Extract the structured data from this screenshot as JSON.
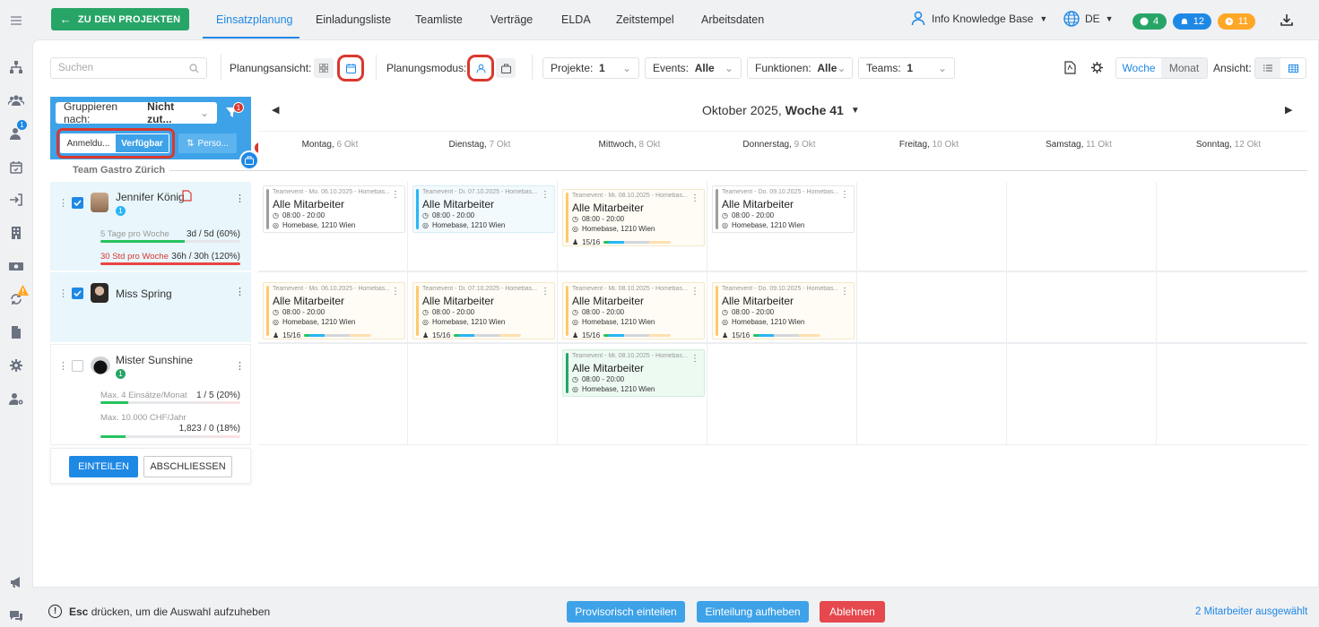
{
  "topbar": {
    "back_label": "ZU DEN PROJEKTEN",
    "tabs": [
      "Einsatzplanung",
      "Einladungsliste",
      "Teamliste",
      "Verträge",
      "ELDA",
      "Zeitstempel",
      "Arbeitsdaten"
    ],
    "user": "Info Knowledge Base",
    "language": "DE",
    "badges": {
      "messages": "4",
      "notifications": "12",
      "timers": "11"
    }
  },
  "toolbar": {
    "search_placeholder": "Suchen",
    "planungsansicht_label": "Planungsansicht:",
    "planungsmodus_label": "Planungsmodus:",
    "filters": [
      {
        "label": "Projekte:",
        "value": "1"
      },
      {
        "label": "Events:",
        "value": "Alle"
      },
      {
        "label": "Funktionen:",
        "value": "Alle"
      },
      {
        "label": "Teams:",
        "value": "1"
      }
    ],
    "woche": "Woche",
    "monat": "Monat",
    "ansicht_label": "Ansicht:"
  },
  "leftpanel": {
    "group_label": "Gruppieren nach:",
    "group_value": "Nicht zut...",
    "filter_badge": "1",
    "seg_left": "Anmeldu...",
    "seg_right": "Verfügbar",
    "sort_label": "Perso...",
    "float_badge": "1",
    "team_name": "Team Gastro Zürich"
  },
  "calendar": {
    "month": "Oktober 2025,",
    "week": "Woche 41",
    "days": [
      {
        "name": "Montag,",
        "date": "6 Okt"
      },
      {
        "name": "Dienstag,",
        "date": "7 Okt"
      },
      {
        "name": "Mittwoch,",
        "date": "8 Okt"
      },
      {
        "name": "Donnerstag,",
        "date": "9 Okt"
      },
      {
        "name": "Freitag,",
        "date": "10 Okt"
      },
      {
        "name": "Samstag,",
        "date": "11 Okt"
      },
      {
        "name": "Sonntag,",
        "date": "12 Okt"
      }
    ]
  },
  "people": [
    {
      "name": "Jennifer König",
      "badge": "1",
      "stat1_label": "5 Tage pro Woche",
      "stat1_value": "3d / 5d (60%)",
      "stat1_pct": 60,
      "stat2_label": "30 Std pro Woche",
      "stat2_value": "36h / 30h (120%)",
      "stat2_pct": 100
    },
    {
      "name": "Miss Spring"
    },
    {
      "name": "Mister Sunshine",
      "badge": "1",
      "stat1_label": "Max. 4 Einsätze/Monat",
      "stat1_value": "1 / 5 (20%)",
      "stat1_pct": 20,
      "stat2_label": "Max. 10.000 CHF/Jahr",
      "stat2_value": "1,823 / 0 (18%)",
      "stat2_pct": 18
    }
  ],
  "events": {
    "r1": [
      {
        "header": "Teamevent - Mo. 06.10.2025 - Homebas...",
        "title": "Alle Mitarbeiter",
        "time": "08:00 - 20:00",
        "place": "Homebase, 1210 Wien",
        "accent": "#9e9e9e"
      },
      {
        "header": "Teamevent - Di. 07.10.2025 - Homebas...",
        "title": "Alle Mitarbeiter",
        "time": "08:00 - 20:00",
        "place": "Homebase, 1210 Wien",
        "accent": "#29b6f6"
      },
      {
        "header": "Teamevent - Mi. 08.10.2025 - Homebas...",
        "title": "Alle Mitarbeiter",
        "time": "08:00 - 20:00",
        "place": "Homebase, 1210 Wien",
        "accent": "#ffc870",
        "count": "15/16"
      },
      {
        "header": "Teamevent - Do. 09.10.2025 - Homebas...",
        "title": "Alle Mitarbeiter",
        "time": "08:00 - 20:00",
        "place": "Homebase, 1210 Wien",
        "accent": "#9e9e9e"
      }
    ],
    "r2": [
      {
        "header": "Teamevent - Mo. 06.10.2025 - Homebas...",
        "title": "Alle Mitarbeiter",
        "time": "08:00 - 20:00",
        "place": "Homebase, 1210 Wien",
        "accent": "#ffc870",
        "count": "15/16"
      },
      {
        "header": "Teamevent - Di. 07.10.2025 - Homebas...",
        "title": "Alle Mitarbeiter",
        "time": "08:00 - 20:00",
        "place": "Homebase, 1210 Wien",
        "accent": "#ffc870",
        "count": "15/16"
      },
      {
        "header": "Teamevent - Mi. 08.10.2025 - Homebas...",
        "title": "Alle Mitarbeiter",
        "time": "08:00 - 20:00",
        "place": "Homebase, 1210 Wien",
        "accent": "#ffc870",
        "count": "15/16"
      },
      {
        "header": "Teamevent - Do. 09.10.2025 - Homebas...",
        "title": "Alle Mitarbeiter",
        "time": "08:00 - 20:00",
        "place": "Homebase, 1210 Wien",
        "accent": "#ffc870",
        "count": "15/16"
      }
    ],
    "r3": [
      {
        "header": "Teamevent - Mi. 08.10.2025 - Homebas...",
        "title": "Alle Mitarbeiter",
        "time": "08:00 - 20:00",
        "place": "Homebase, 1210 Wien",
        "accent": "#27a567"
      }
    ]
  },
  "actions": {
    "einteilen": "EINTEILEN",
    "abschliessen": "ABSCHLIESSEN"
  },
  "footer": {
    "hint_key": "Esc",
    "hint_text": "drücken, um die Auswahl aufzuheben",
    "provisorisch": "Provisorisch einteilen",
    "aufheben": "Einteilung aufheben",
    "ablehnen": "Ablehnen",
    "selected": "2 Mitarbeiter ausgewählt"
  },
  "colors": {
    "primary": "#1e88e5",
    "green": "#27a567",
    "red": "#d9382f",
    "amber": "#ffa726"
  }
}
